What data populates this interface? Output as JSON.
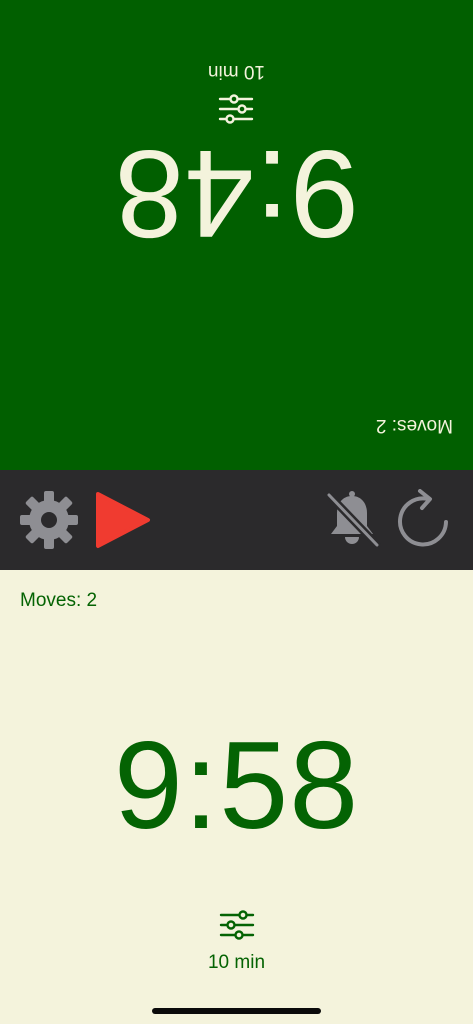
{
  "top_player": {
    "moves_label": "Moves: 2",
    "clock": "9:48",
    "time_control": "10 min",
    "icon": "sliders-icon",
    "panel_color": "#015f00",
    "text_color": "#f4f3dc"
  },
  "bottom_player": {
    "moves_label": "Moves: 2",
    "clock": "9:58",
    "time_control": "10 min",
    "icon": "sliders-icon",
    "panel_color": "#f4f3dc",
    "text_color": "#046303"
  },
  "toolbar": {
    "background": "#2b2a2c",
    "buttons": [
      {
        "icon": "gear-icon",
        "color": "#8e8e93"
      },
      {
        "icon": "play-icon",
        "color": "#f03b30"
      },
      {
        "icon": "bell-slash-icon",
        "color": "#8e8e93"
      },
      {
        "icon": "reset-icon",
        "color": "#8e8e93"
      }
    ]
  }
}
